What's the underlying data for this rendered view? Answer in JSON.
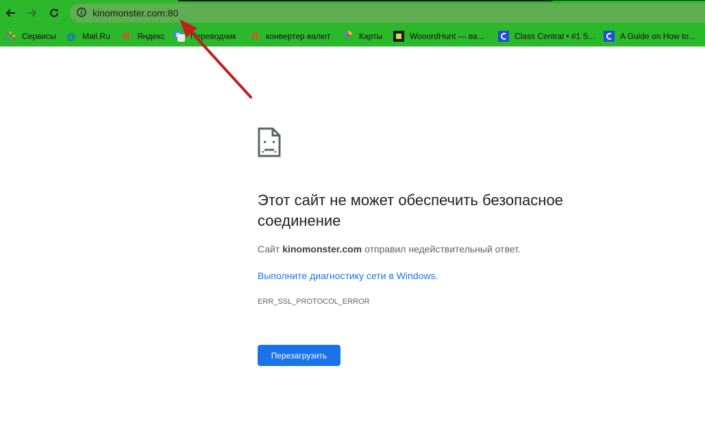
{
  "browser": {
    "url": "kinomonster.com:80",
    "colors": {
      "toolbar": "#2bb82b",
      "omnibox": "#5fae52"
    }
  },
  "bookmarks": [
    {
      "label": "Сервисы",
      "icon": "apps-grid-icon"
    },
    {
      "label": "Mail.Ru",
      "icon": "mailru-icon"
    },
    {
      "label": "Яндекс",
      "icon": "yandex-icon"
    },
    {
      "label": "Переводчик",
      "icon": "google-translate-icon"
    },
    {
      "label": "конвертер валют",
      "icon": "yandex-icon"
    },
    {
      "label": "Карты",
      "icon": "google-maps-icon"
    },
    {
      "label": "WooordHunt — ва...",
      "icon": "wooordhunt-icon"
    },
    {
      "label": "Class Central • #1 S...",
      "icon": "classcentral-icon"
    },
    {
      "label": "A Guide on How to...",
      "icon": "classcentral-icon"
    }
  ],
  "error_page": {
    "icon": "sad-page-icon",
    "title": "Этот сайт не может обеспечить безопасное соединение",
    "description_prefix": "Сайт",
    "description_host": "kinomonster.com",
    "description_suffix": "отправил недействительный ответ.",
    "diagnostics_link": "Выполните диагностику сети в Windows.",
    "error_code": "ERR_SSL_PROTOCOL_ERROR",
    "reload_button": "Перезагрузить",
    "colors": {
      "link": "#1a73e8",
      "button": "#1a73e8",
      "heading": "#202124",
      "text": "#5f6368"
    }
  },
  "annotation": {
    "icon": "red-arrow-icon",
    "color": "#c0201e"
  }
}
